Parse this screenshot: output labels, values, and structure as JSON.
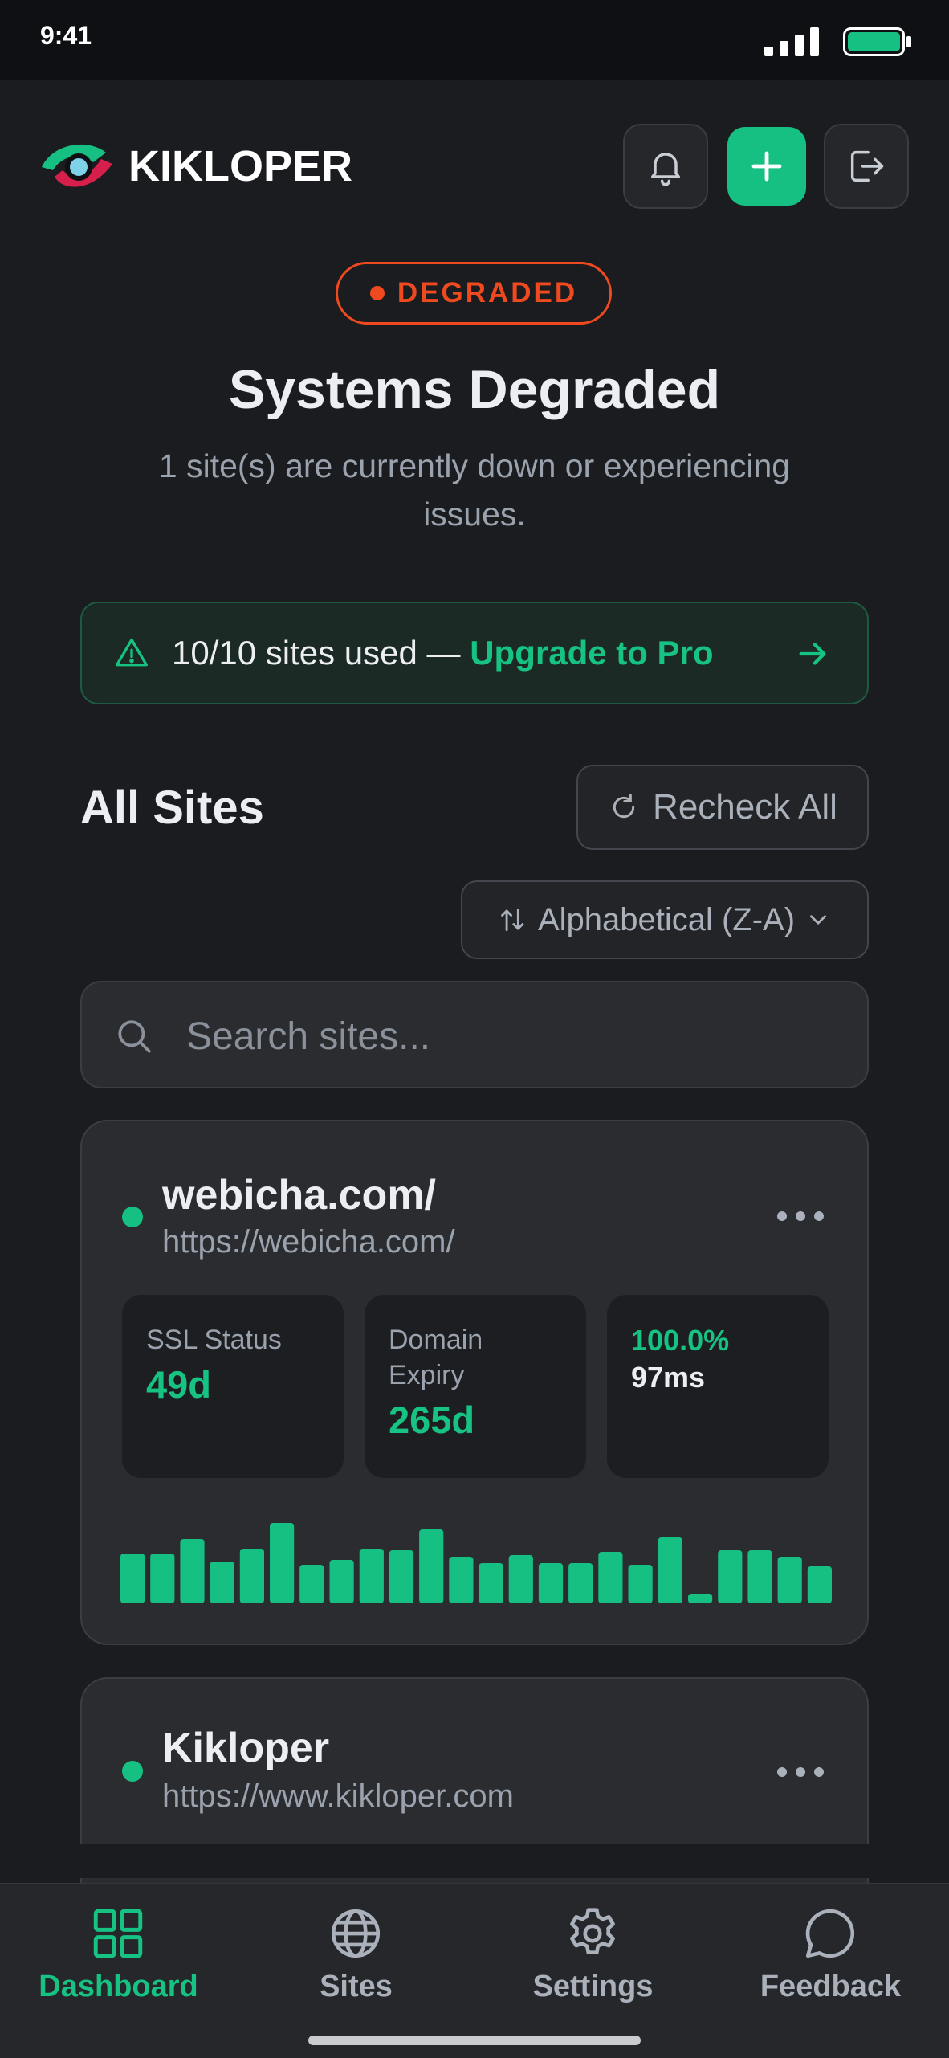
{
  "status_bar": {
    "time": "9:41"
  },
  "header": {
    "brand": "KIKLOPER"
  },
  "status": {
    "badge": "DEGRADED",
    "title": "Systems Degraded",
    "subtitle": "1 site(s) are currently down or experiencing issues."
  },
  "banner": {
    "usage": "10/10 sites used — ",
    "link": "Upgrade to Pro"
  },
  "sites_section": {
    "title": "All Sites",
    "recheck_label": "Recheck All",
    "sort_label": "Alphabetical (Z-A)"
  },
  "search": {
    "placeholder": "Search sites...",
    "value": ""
  },
  "sites": [
    {
      "name": "webicha.com/",
      "url": "https://webicha.com/",
      "status_color": "#16c083",
      "ssl": {
        "label": "SSL Status",
        "value": "49d"
      },
      "domain": {
        "label": "Domain Expiry",
        "value": "265d"
      },
      "uptime": "100.0%",
      "response": "97ms",
      "history": [
        0.62,
        0.62,
        0.8,
        0.52,
        0.68,
        1.0,
        0.48,
        0.54,
        0.68,
        0.66,
        0.92,
        0.58,
        0.5,
        0.6,
        0.5,
        0.5,
        0.64,
        0.48,
        0.82,
        0.12,
        0.66,
        0.66,
        0.58,
        0.46
      ]
    },
    {
      "name": "Kikloper",
      "url": "https://www.kikloper.com",
      "status_color": "#16c083"
    }
  ],
  "bottom_nav": [
    {
      "label": "Dashboard",
      "icon": "grid-icon",
      "active": true
    },
    {
      "label": "Sites",
      "icon": "globe-icon",
      "active": false
    },
    {
      "label": "Settings",
      "icon": "gear-icon",
      "active": false
    },
    {
      "label": "Feedback",
      "icon": "chat-bubble-icon",
      "active": false
    }
  ],
  "colors": {
    "accent": "#16c083",
    "degraded": "#ef4a1f",
    "background": "#1b1c1f",
    "card": "#2a2c30"
  }
}
